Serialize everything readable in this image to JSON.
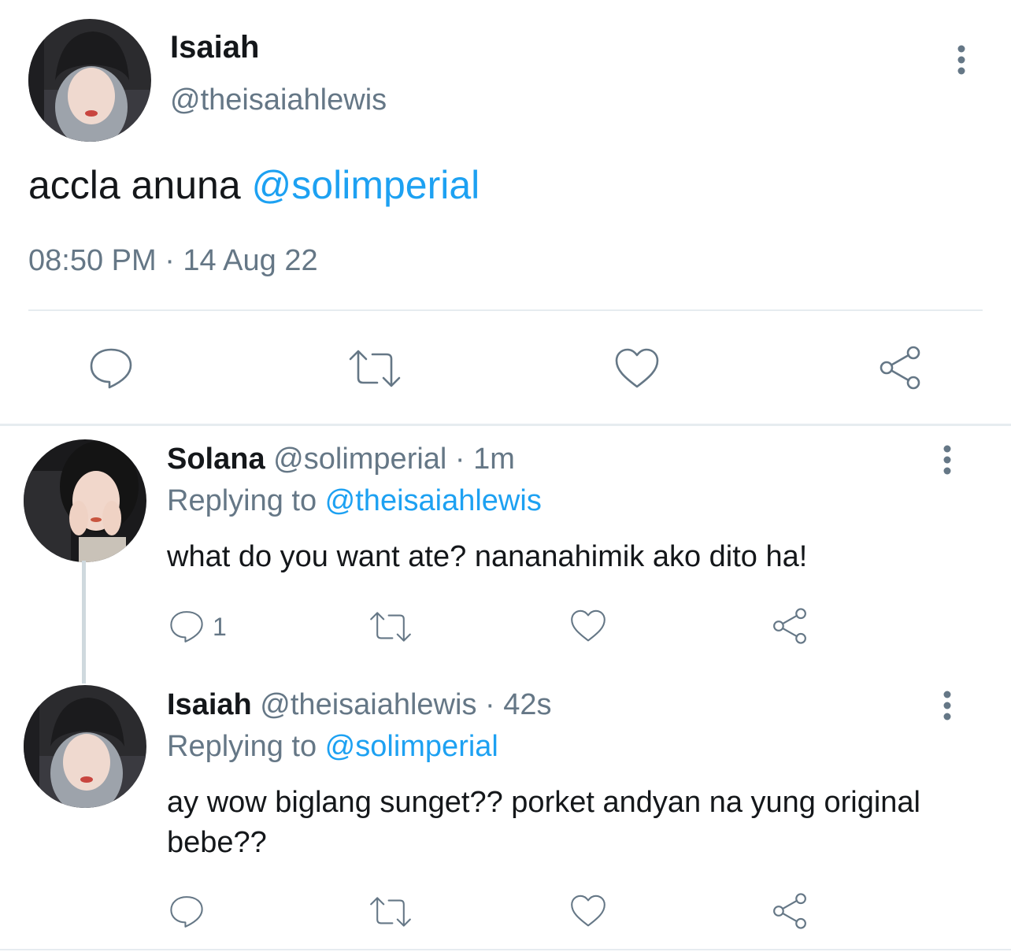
{
  "main_tweet": {
    "name": "Isaiah",
    "handle": "@theisaiahlewis",
    "text_prefix": "accla anuna ",
    "mention": "@solimperial",
    "timestamp": "08:50 PM · 14 Aug 22",
    "actions": [
      "reply-icon",
      "retweet-icon",
      "like-icon",
      "share-icon"
    ]
  },
  "replies": [
    {
      "name": "Solana",
      "handle": "@solimperial",
      "time": "1m",
      "separator": " · ",
      "replying_label": "Replying to ",
      "replying_to": "@theisaiahlewis",
      "text": "what do you want ate? nananahimik ako dito ha!",
      "reply_count": "1"
    },
    {
      "name": "Isaiah",
      "handle": "@theisaiahlewis",
      "time": "42s",
      "separator": " · ",
      "replying_label": "Replying to ",
      "replying_to": "@solimperial",
      "text": "ay wow biglang sunget?? porket andyan na yung original bebe??",
      "reply_count": ""
    }
  ],
  "colors": {
    "text": "#14171a",
    "secondary": "#657786",
    "link": "#1da1f2",
    "divider": "#e6ecf0"
  }
}
